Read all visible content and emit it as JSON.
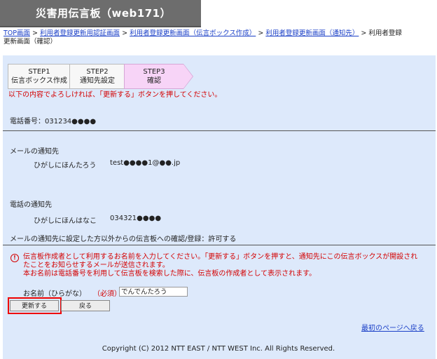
{
  "header": {
    "title": "災害用伝言板（web171）"
  },
  "breadcrumb": {
    "items": [
      "TOP画面",
      "利用者登録更新用認証画面",
      "利用者登録更新画面（伝言ボックス作成）",
      "利用者登録更新画面（通知先）"
    ],
    "separator": ">",
    "current_line1": "利用者登録",
    "current_line2": "更新画面（確認）"
  },
  "steps": [
    {
      "num": "STEP1",
      "label": "伝言ボックス作成"
    },
    {
      "num": "STEP2",
      "label": "通知先設定"
    },
    {
      "num": "STEP3",
      "label": "確認"
    }
  ],
  "instruction": "以下の内容でよろしければ、「更新する」ボタンを押してください。",
  "phone": {
    "label": "電話番号：",
    "value": "031234●●●●"
  },
  "mail_notify": {
    "heading": "メールの通知先",
    "name": "ひがしにほんたろう",
    "address": "test●●●●1@●●.jp"
  },
  "phone_notify": {
    "heading": "電話の通知先",
    "name": "ひがしにほんはなこ",
    "number": "034321●●●●"
  },
  "permission": "メールの通知先に設定した方以外からの伝言板への確認/登録：許可する",
  "warning": {
    "line1": "伝言板作成者として利用するお名前を入力してください。「更新する」ボタンを押すと、通知先にこの伝言ボックスが開設され",
    "line2": "たことをお知らせするメールが送信されます。",
    "line3": "本お名前は電話番号を利用して伝言板を検索した際に、伝言板の作成者として表示されます。"
  },
  "name_field": {
    "label": "お名前（ひらがな）",
    "required": "（必須）",
    "value": "でんでんたろう"
  },
  "buttons": {
    "update": "更新する",
    "back": "戻る"
  },
  "first_page_link": "最初のページへ戻る",
  "footer": "Copyright (C) 2012 NTT EAST / NTT WEST Inc. All Rights Reserved.",
  "colors": {
    "accent_red": "#d40000",
    "panel_bg": "#dde9fb",
    "link": "#1a3fc7",
    "step_current": "#f7d4f7"
  }
}
